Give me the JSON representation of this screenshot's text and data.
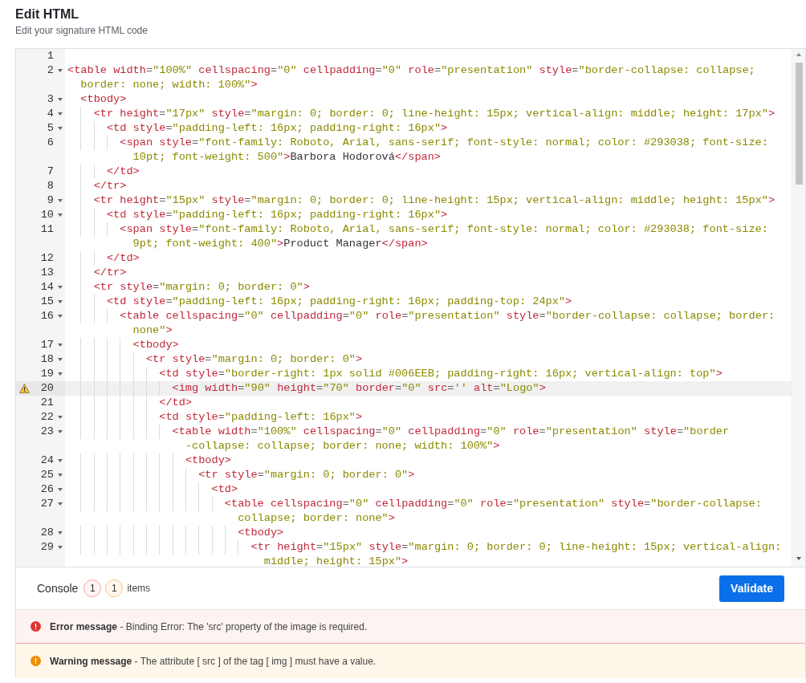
{
  "header": {
    "title": "Edit HTML",
    "subtitle": "Edit your signature HTML code"
  },
  "editor": {
    "lines": [
      {
        "number": "1"
      },
      {
        "number": "2",
        "foldable": true,
        "text": "<table width=\"100%\" cellspacing=\"0\" cellpadding=\"0\" role=\"presentation\" style=\"border-collapse: collapse;",
        "continuation": "border: none; width: 100%\">"
      },
      {
        "number": "3",
        "foldable": true,
        "text": "  <tbody>"
      },
      {
        "number": "4",
        "foldable": true,
        "text": "    <tr height=\"17px\" style=\"margin: 0; border: 0; line-height: 15px; vertical-align: middle; height: 17px\">"
      },
      {
        "number": "5",
        "foldable": true,
        "text": "      <td style=\"padding-left: 16px; padding-right: 16px\">"
      },
      {
        "number": "6",
        "text": "        <span style=\"font-family: Roboto, Arial, sans-serif; font-style: normal; color: #293038; font-size:",
        "continuation": "10pt; font-weight: 500\">Barbora Hodorová</span>"
      },
      {
        "number": "7",
        "text": "      </td>"
      },
      {
        "number": "8",
        "text": "    </tr>"
      },
      {
        "number": "9",
        "foldable": true,
        "text": "    <tr height=\"15px\" style=\"margin: 0; border: 0; line-height: 15px; vertical-align: middle; height: 15px\">"
      },
      {
        "number": "10",
        "foldable": true,
        "text": "      <td style=\"padding-left: 16px; padding-right: 16px\">"
      },
      {
        "number": "11",
        "text": "        <span style=\"font-family: Roboto, Arial, sans-serif; font-style: normal; color: #293038; font-size:",
        "continuation": "9pt; font-weight: 400\">Product Manager</span>"
      },
      {
        "number": "12",
        "text": "      </td>"
      },
      {
        "number": "13",
        "text": "    </tr>"
      },
      {
        "number": "14",
        "foldable": true,
        "text": "    <tr style=\"margin: 0; border: 0\">"
      },
      {
        "number": "15",
        "foldable": true,
        "text": "      <td style=\"padding-left: 16px; padding-right: 16px; padding-top: 24px\">"
      },
      {
        "number": "16",
        "foldable": true,
        "text": "        <table cellspacing=\"0\" cellpadding=\"0\" role=\"presentation\" style=\"border-collapse: collapse; border:",
        "continuation": "none\">"
      },
      {
        "number": "17",
        "foldable": true,
        "text": "          <tbody>"
      },
      {
        "number": "18",
        "foldable": true,
        "text": "            <tr style=\"margin: 0; border: 0\">"
      },
      {
        "number": "19",
        "foldable": true,
        "text": "              <td style=\"border-right: 1px solid #006EEB; padding-right: 16px; vertical-align: top\">"
      },
      {
        "number": "20",
        "warning": true,
        "active": true,
        "text": "                <img width=\"90\" height=\"70\" border=\"0\" src='' alt=\"Logo\">"
      },
      {
        "number": "21",
        "text": "              </td>"
      },
      {
        "number": "22",
        "foldable": true,
        "text": "              <td style=\"padding-left: 16px\">"
      },
      {
        "number": "23",
        "foldable": true,
        "text": "                <table width=\"100%\" cellspacing=\"0\" cellpadding=\"0\" role=\"presentation\" style=\"border",
        "continuation": "-collapse: collapse; border: none; width: 100%\">"
      },
      {
        "number": "24",
        "foldable": true,
        "text": "                  <tbody>"
      },
      {
        "number": "25",
        "foldable": true,
        "text": "                    <tr style=\"margin: 0; border: 0\">"
      },
      {
        "number": "26",
        "foldable": true,
        "text": "                      <td>"
      },
      {
        "number": "27",
        "foldable": true,
        "text": "                        <table cellspacing=\"0\" cellpadding=\"0\" role=\"presentation\" style=\"border-collapse:",
        "continuation": "collapse; border: none\">"
      },
      {
        "number": "28",
        "foldable": true,
        "text": "                          <tbody>"
      },
      {
        "number": "29",
        "foldable": true,
        "text": "                            <tr height=\"15px\" style=\"margin: 0; border: 0; line-height: 15px; vertical-align:",
        "continuation": "middle; height: 15px\">"
      }
    ]
  },
  "console": {
    "title": "Console",
    "counts": [
      {
        "kind": "error",
        "value": "1"
      },
      {
        "kind": "warning",
        "value": "1"
      }
    ],
    "counts_label": "items",
    "validate_button": "Validate",
    "messages": [
      {
        "kind": "error",
        "text": "**Error message** - Binding Error: The 'src' property of the image is required."
      },
      {
        "kind": "warning",
        "text": "**Warning message** - The attribute [ src ] of the tag [ img ] must have a value."
      }
    ]
  }
}
